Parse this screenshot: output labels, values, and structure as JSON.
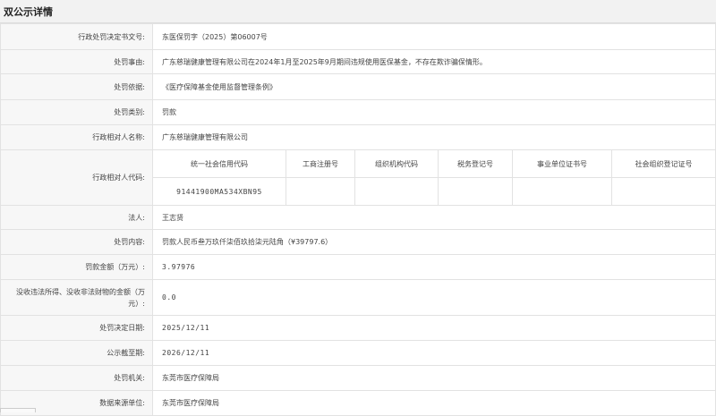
{
  "header": {
    "title": "双公示详情"
  },
  "rows": [
    {
      "label": "行政处罚决定书文号:",
      "value": "东医保罚字（2025）第06007号"
    },
    {
      "label": "处罚事由:",
      "value": "广东慈瑞健康管理有限公司在2024年1月至2025年9月期间违规使用医保基金，不存在欺诈骗保情形。"
    },
    {
      "label": "处罚依据:",
      "value": "《医疗保障基金使用监督管理条例》"
    },
    {
      "label": "处罚类别:",
      "value": "罚款"
    },
    {
      "label": "行政相对人名称:",
      "value": "广东慈瑞健康管理有限公司"
    }
  ],
  "code_section": {
    "label": "行政相对人代码:",
    "headers": [
      "统一社会信用代码",
      "工商注册号",
      "组织机构代码",
      "税务登记号",
      "事业单位证书号",
      "社会组织登记证号"
    ],
    "values": [
      "91441900MA534XBN95",
      "",
      "",
      "",
      "",
      ""
    ]
  },
  "rows2": [
    {
      "label": "法人:",
      "value": "王志贤"
    },
    {
      "label": "处罚内容:",
      "value": "罚款人民币叁万玖仟柒佰玖拾柒元陆角（¥39797.6）"
    },
    {
      "label": "罚款金额（万元）:",
      "value": "3.97976"
    },
    {
      "label": "没收违法所得、没收非法财物的金额（万元）:",
      "value": "0.0"
    },
    {
      "label": "处罚决定日期:",
      "value": "2025/12/11"
    },
    {
      "label": "公示截至期:",
      "value": "2026/12/11"
    },
    {
      "label": "处罚机关:",
      "value": "东莞市医疗保障局"
    },
    {
      "label": "数据来源单位:",
      "value": "东莞市医疗保障局"
    }
  ]
}
